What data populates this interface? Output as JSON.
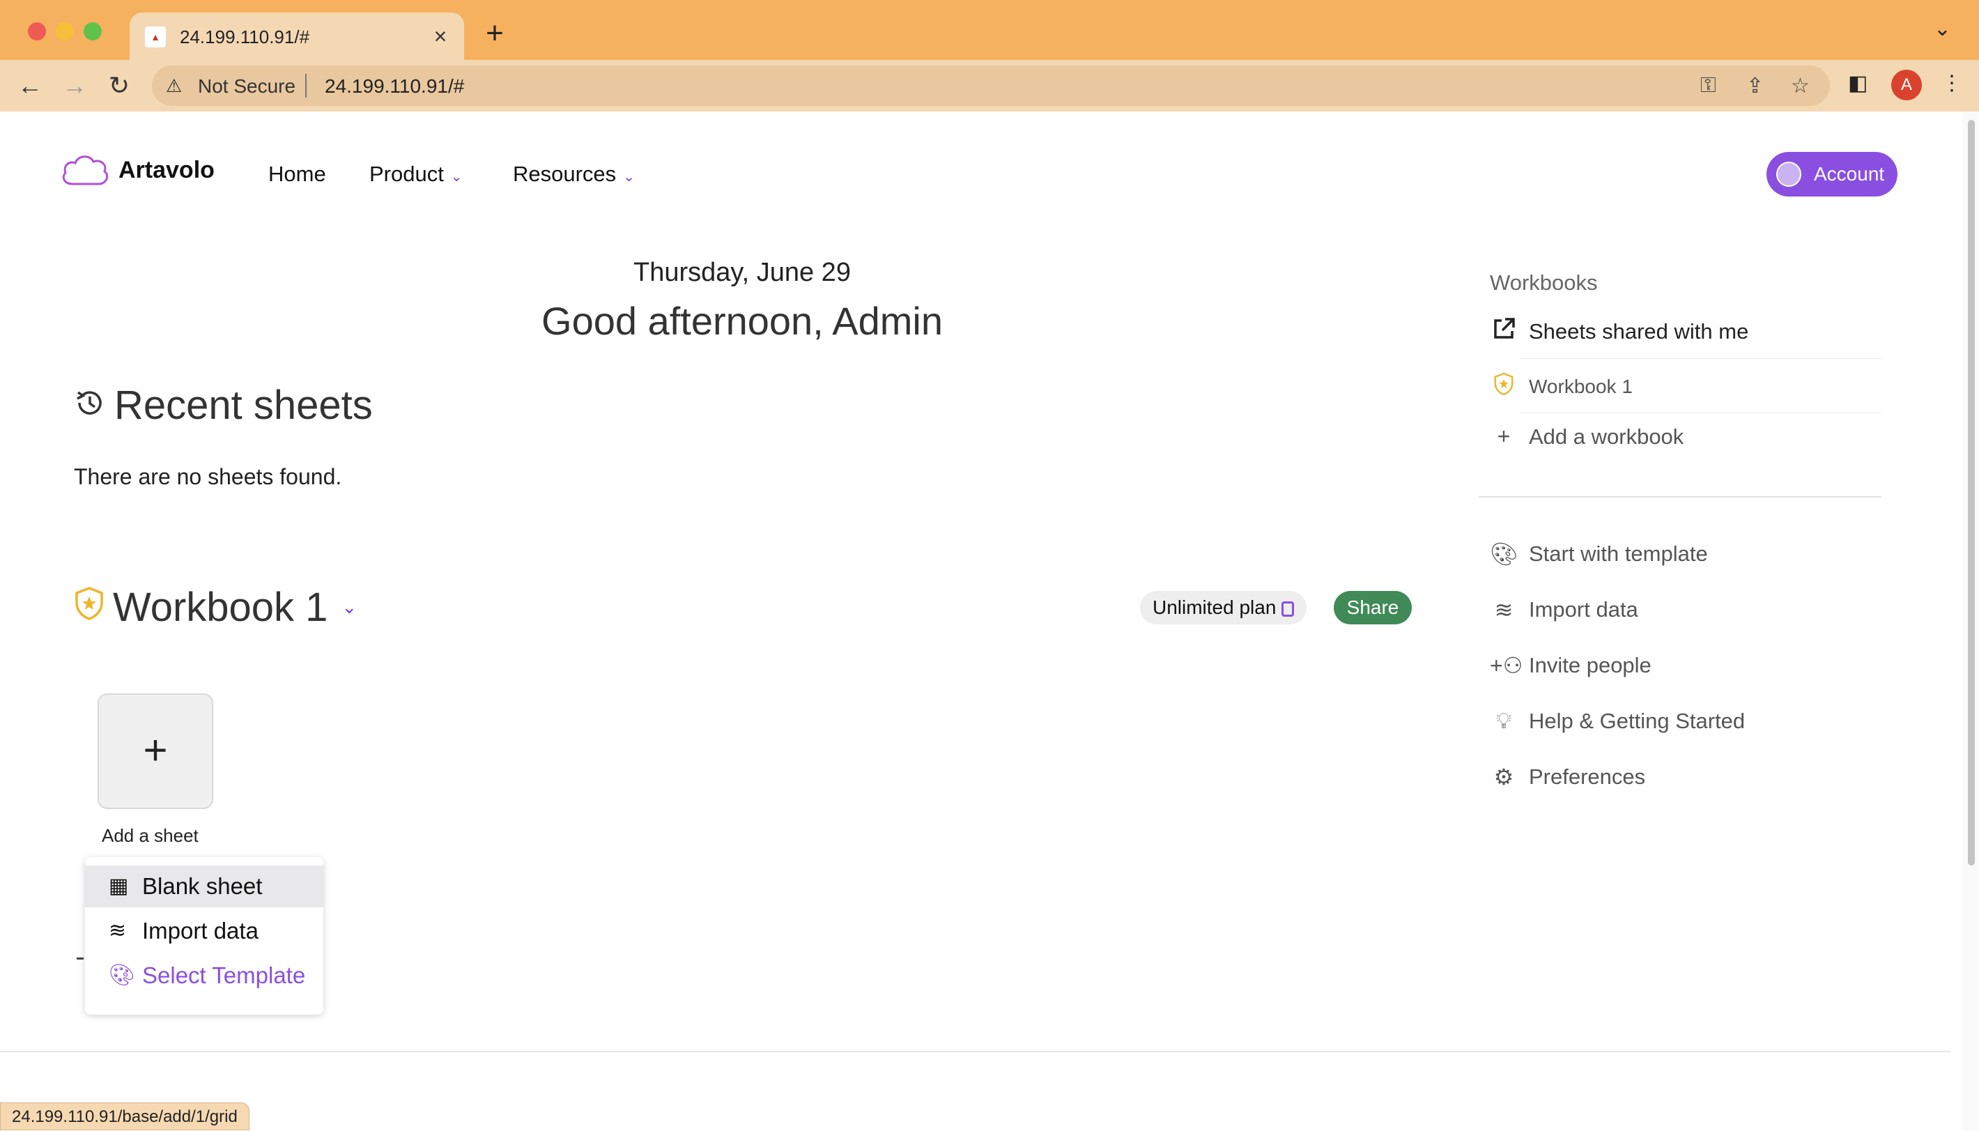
{
  "browser": {
    "tab_title": "24.199.110.91/#",
    "url_warning": "Not Secure",
    "url": "24.199.110.91/#",
    "profile_initial": "A",
    "status_url": "24.199.110.91/base/add/1/grid"
  },
  "header": {
    "brand": "Artavolo",
    "nav": {
      "home": "Home",
      "product": "Product",
      "resources": "Resources"
    },
    "account": "Account"
  },
  "main": {
    "date": "Thursday, June 29",
    "greeting": "Good afternoon, Admin",
    "recent_title": "Recent sheets",
    "recent_empty": "There are no sheets found.",
    "workbook_title": "Workbook 1",
    "plan_label": "Unlimited plan",
    "share_label": "Share",
    "add_sheet_label": "Add a sheet",
    "add_menu": {
      "blank": "Blank sheet",
      "import": "Import data",
      "template": "Select Template"
    }
  },
  "sidebar": {
    "heading": "Workbooks",
    "shared": "Sheets shared with me",
    "workbook": "Workbook 1",
    "add_workbook": "Add a workbook",
    "start_template": "Start with template",
    "import_data": "Import data",
    "invite": "Invite people",
    "help": "Help & Getting Started",
    "preferences": "Preferences"
  },
  "colors": {
    "accent": "#8a4fe0",
    "share": "#3f8a57",
    "browser_frame": "#f6b15e"
  }
}
